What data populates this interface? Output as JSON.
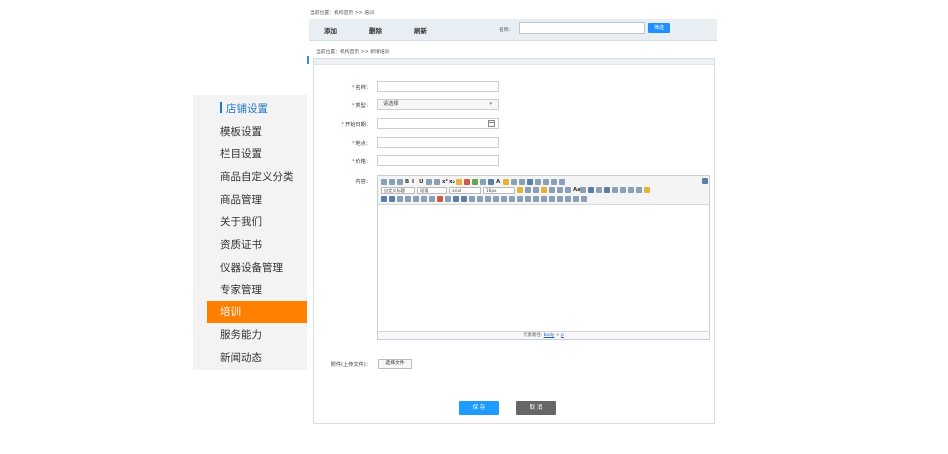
{
  "sidebar": {
    "items": [
      {
        "label": "店铺设置"
      },
      {
        "label": "模板设置"
      },
      {
        "label": "栏目设置"
      },
      {
        "label": "商品自定义分类"
      },
      {
        "label": "商品管理"
      },
      {
        "label": "关于我们"
      },
      {
        "label": "资质证书"
      },
      {
        "label": "仪器设备管理"
      },
      {
        "label": "专家管理"
      },
      {
        "label": "培训"
      },
      {
        "label": "服务能力"
      },
      {
        "label": "新闻动态"
      }
    ],
    "active_index": 9,
    "accent_color": "#ff7f00",
    "header_color": "#1e78c8"
  },
  "list_frame": {
    "breadcrumb": "当前位置：机构首页 >> 培训",
    "toolbar": {
      "add_label": "添加",
      "delete_label": "删除",
      "refresh_label": "刷新",
      "name_label": "名称：",
      "search_value": "",
      "search_button": "筛选"
    }
  },
  "form_frame": {
    "breadcrumb": "当前位置：机构首页 >> 新增培训",
    "fields": {
      "name_label": "名称：",
      "type_label": "类型：",
      "type_value": "请选择",
      "date_label": "开始日期：",
      "place_label": "地点：",
      "price_label": "价格：",
      "content_label": "内容：",
      "attachment_label": "附件(上传文件)：",
      "attachment_button": "选择文件"
    },
    "editor": {
      "format_select": "自定义标题",
      "paragraph_select": "段落",
      "font_select": "arial",
      "size_select": "16px",
      "status_prefix": "元素路径:",
      "status_path_1": "body",
      "status_sep": ">",
      "status_path_2": "p"
    },
    "buttons": {
      "save": "保 存",
      "cancel": "取 消"
    }
  }
}
